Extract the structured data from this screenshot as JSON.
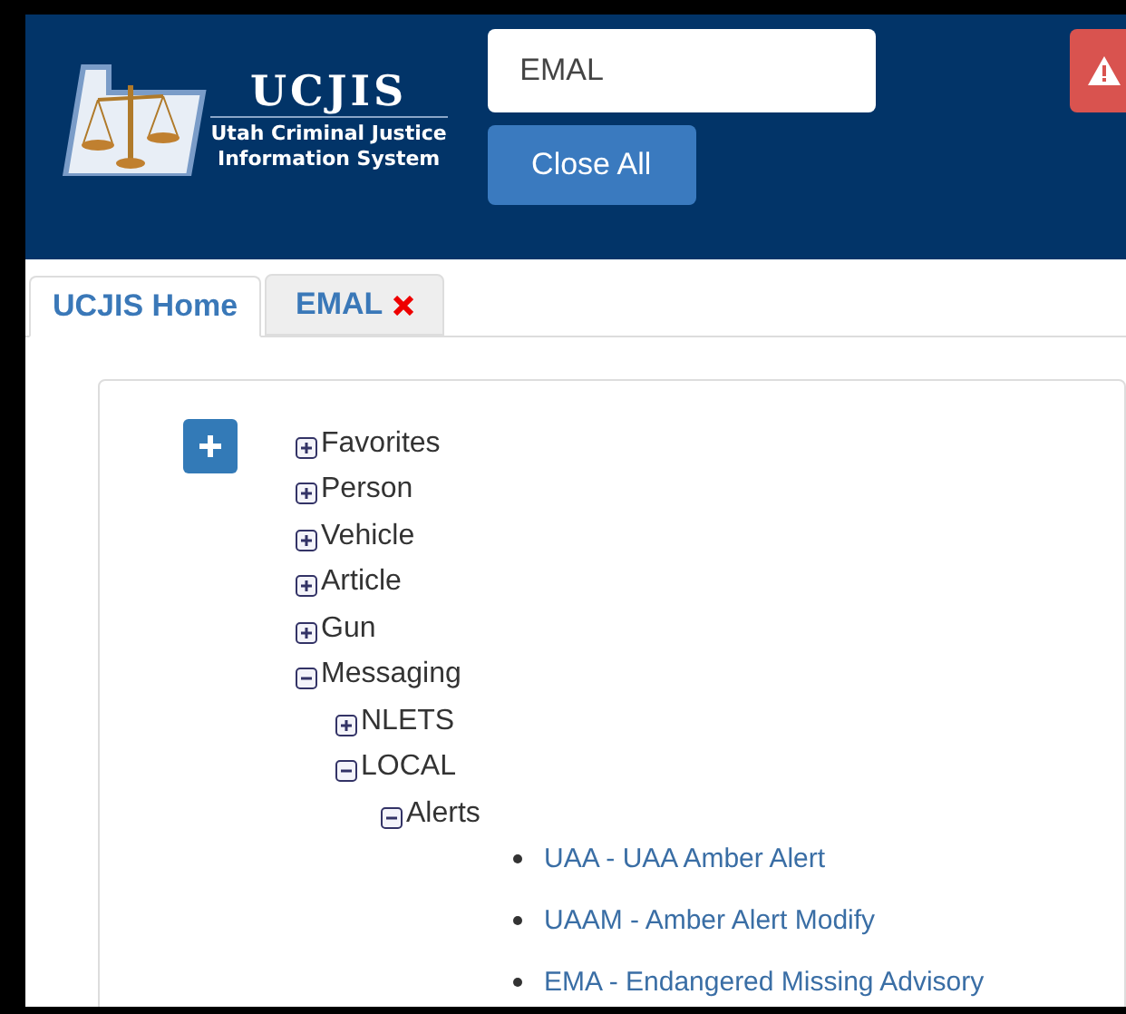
{
  "header": {
    "logo_title": "UCJIS",
    "logo_subtitle": [
      "Utah Criminal Justice",
      "Information System"
    ],
    "search": {
      "value": "EMAL"
    },
    "close_all_button": "Close All"
  },
  "tabs": [
    {
      "label": "UCJIS Home",
      "selected": true,
      "closable": false
    },
    {
      "label": "EMAL",
      "selected": false,
      "closable": true
    }
  ],
  "tree": [
    {
      "label": "Favorites",
      "kind": "node",
      "expanded": false
    },
    {
      "label": "Person",
      "kind": "node",
      "expanded": false
    },
    {
      "label": "Vehicle",
      "kind": "node",
      "expanded": false
    },
    {
      "label": "Article",
      "kind": "node",
      "expanded": false
    },
    {
      "label": "Gun",
      "kind": "node",
      "expanded": false
    },
    {
      "label": "Messaging",
      "kind": "node",
      "expanded": true,
      "children": [
        {
          "label": "NLETS",
          "kind": "node",
          "expanded": false
        },
        {
          "label": "LOCAL",
          "kind": "node",
          "expanded": true,
          "children": [
            {
              "label": "Alerts",
              "kind": "node",
              "expanded": true,
              "children": [
                {
                  "label": "UAA - UAA Amber Alert",
                  "kind": "link"
                },
                {
                  "label": "UAAM - Amber Alert Modify",
                  "kind": "link"
                },
                {
                  "label": "EMA - Endangered Missing Advisory",
                  "kind": "link"
                }
              ]
            }
          ]
        }
      ]
    }
  ]
}
